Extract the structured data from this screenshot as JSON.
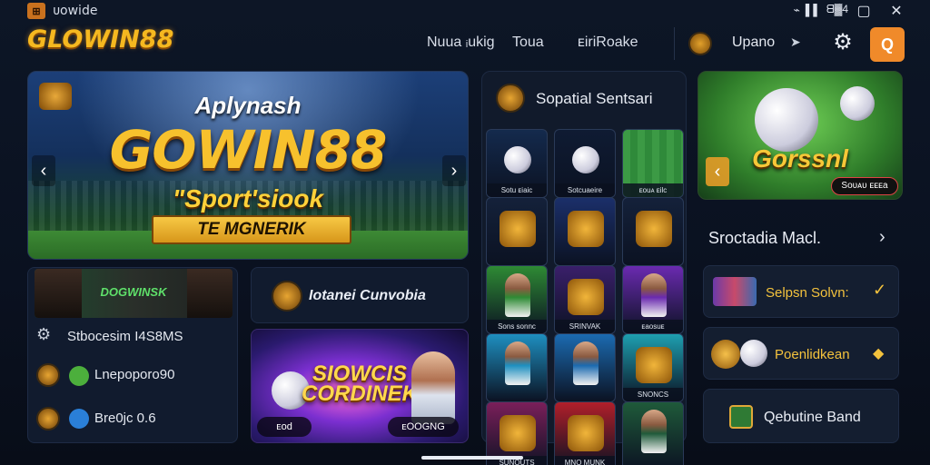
{
  "window": {
    "title": "ᴜowide",
    "tray": [
      "⌁",
      "▌▌",
      "ᗺ▓4"
    ]
  },
  "header": {
    "logo": "GLOWIN88",
    "nav": [
      "Nuua ᵢukig",
      "Toua",
      "ᴇiriRoake"
    ],
    "promo_label": "Upano",
    "search_label": "Q"
  },
  "hero": {
    "small_title": "Aplynash",
    "big_title": "GOWIN88",
    "subtitle": "\"Sport'siook",
    "ribbon": "TE MGNERIK"
  },
  "featured": {
    "title": "Sopatial Sentsari",
    "tiles": [
      {
        "caption": "Sotu ᴇiaic",
        "kind": "ball",
        "bg": "#142a4d"
      },
      {
        "caption": "Sotcuaeire",
        "kind": "ball",
        "bg": "#0f1b33"
      },
      {
        "caption": "ᴇouᴀ ᴇilc",
        "kind": "field",
        "bg": "#2c7a3a"
      },
      {
        "caption": "",
        "kind": "emblem",
        "bg": "#14213a"
      },
      {
        "caption": "",
        "kind": "emblem",
        "bg": "#1b2f6a"
      },
      {
        "caption": "",
        "kind": "emblem",
        "bg": "#14213a"
      },
      {
        "caption": "Sons sonnc",
        "kind": "player",
        "bg": "#2e8a34"
      },
      {
        "caption": "SRINVAK HAAIER",
        "kind": "emblem",
        "bg": "#3a1f6a"
      },
      {
        "caption": "ᴇaosuᴇ",
        "kind": "player",
        "bg": "#6a2ab0"
      },
      {
        "caption": "",
        "kind": "player",
        "bg": "#1e8fc0"
      },
      {
        "caption": "",
        "kind": "player",
        "bg": "#1b6ab0"
      },
      {
        "caption": "SNONCS",
        "kind": "emblem",
        "bg": "#1e9fb0"
      },
      {
        "caption": "SUNOUTS GLOOUNRS",
        "kind": "emblem",
        "bg": "#7a1f5a"
      },
      {
        "caption": "MNO MUNK",
        "kind": "emblem",
        "bg": "#b01f2a"
      },
      {
        "caption": "",
        "kind": "player",
        "bg": "#1f5a3a"
      }
    ]
  },
  "soccer_card": {
    "title": "Gorssnl",
    "badge": "Soᴜᴀᴜ ᴇᴇᴇa"
  },
  "right_list": {
    "heading": "Sroctadia Macl.",
    "items": [
      {
        "label": "Selpsn Solvn:",
        "icon": "check-icon"
      },
      {
        "label": "Poenlidkean",
        "icon": "chevron-icon"
      },
      {
        "label": "Qebutine Band",
        "icon": "ticket-icon"
      }
    ]
  },
  "left_card": {
    "banner_text": "DOGWINSK",
    "rows": [
      "Stbocesim I4S8MS",
      "Lnepoporo90",
      "Bre0jc 0.6"
    ]
  },
  "mid_card": {
    "label": "Iotanei Cunvobia"
  },
  "promo_banner": {
    "title_1": "SIOWCIS",
    "title_2": "CORDINEK",
    "left_chip": "ᴇod",
    "right_chip": "ᴇOOGNG"
  },
  "colors": {
    "accent_gold": "#f5b820",
    "search_orange": "#f08a2a",
    "panel_bg": "#111b2e"
  }
}
